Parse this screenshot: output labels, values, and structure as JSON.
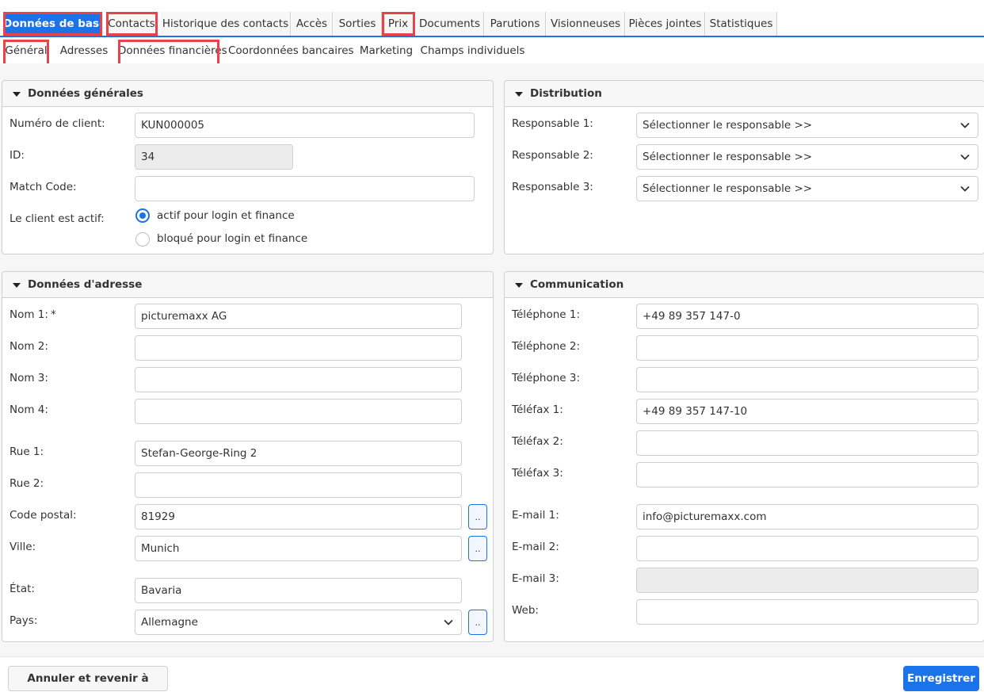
{
  "tabs": [
    {
      "label": "Données de base"
    },
    {
      "label": "Contacts"
    },
    {
      "label": "Historique des contacts"
    },
    {
      "label": "Accès"
    },
    {
      "label": "Sorties"
    },
    {
      "label": "Prix"
    },
    {
      "label": "Documents"
    },
    {
      "label": "Parutions"
    },
    {
      "label": "Visionneuses"
    },
    {
      "label": "Pièces jointes"
    },
    {
      "label": "Statistiques"
    }
  ],
  "subtabs": [
    {
      "label": "Général"
    },
    {
      "label": "Adresses"
    },
    {
      "label": "Données financières"
    },
    {
      "label": "Coordonnées bancaires"
    },
    {
      "label": "Marketing"
    },
    {
      "label": "Champs individuels"
    }
  ],
  "general": {
    "title": "Données générales",
    "customer_number_label": "Numéro de client:",
    "customer_number": "KUN000005",
    "id_label": "ID:",
    "id": "34",
    "match_code_label": "Match Code:",
    "match_code": "",
    "active_label": "Le client est actif:",
    "radio_active": "actif pour login et finance",
    "radio_blocked": "bloqué pour login et finance"
  },
  "distribution": {
    "title": "Distribution",
    "resp1_label": "Responsable 1:",
    "resp2_label": "Responsable 2:",
    "resp3_label": "Responsable 3:",
    "resp1_value": "Sélectionner le responsable >>",
    "resp2_value": "Sélectionner le responsable >>",
    "resp3_value": "Sélectionner le responsable >>"
  },
  "address": {
    "title": "Données d'adresse",
    "name1_label": "Nom 1:",
    "required_mark": "*",
    "name1": "picturemaxx AG",
    "name2_label": "Nom 2:",
    "name2": "",
    "name3_label": "Nom 3:",
    "name3": "",
    "name4_label": "Nom 4:",
    "name4": "",
    "street1_label": "Rue 1:",
    "street1": "Stefan-George-Ring 2",
    "street2_label": "Rue 2:",
    "street2": "",
    "postal_label": "Code postal:",
    "postal": "81929",
    "city_label": "Ville:",
    "city": "Munich",
    "state_label": "État:",
    "state": "Bavaria",
    "country_label": "Pays:",
    "country": "Allemagne",
    "lookup_label": ".."
  },
  "communication": {
    "title": "Communication",
    "phone1_label": "Téléphone 1:",
    "phone1": "+49 89 357 147-0",
    "phone2_label": "Téléphone 2:",
    "phone2": "",
    "phone3_label": "Téléphone 3:",
    "phone3": "",
    "fax1_label": "Téléfax 1:",
    "fax1": "+49 89 357 147-10",
    "fax2_label": "Téléfax 2:",
    "fax2": "",
    "fax3_label": "Téléfax 3:",
    "fax3": "",
    "email1_label": "E-mail 1:",
    "email1": "info@picturemaxx.com",
    "email2_label": "E-mail 2:",
    "email2": "",
    "email3_label": "E-mail 3:",
    "email3": "",
    "web_label": "Web:",
    "web": ""
  },
  "footer": {
    "cancel_label": "Annuler et revenir à l'aperçu",
    "save_label": "Enregistrer"
  },
  "colors": {
    "accent": "#1a73e8",
    "highlight": "#e8434a"
  }
}
